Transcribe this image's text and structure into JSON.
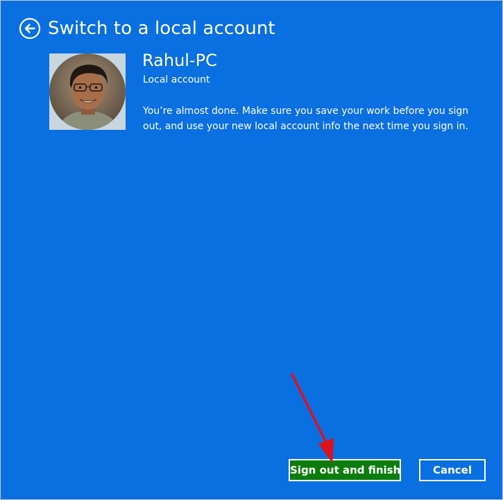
{
  "dialog": {
    "title": "Switch to a local account",
    "back_icon": "back-arrow-icon",
    "background_color": "#0a6fe0"
  },
  "account": {
    "name": "Rahul-PC",
    "type": "Local account",
    "avatar_icon": "user-photo"
  },
  "message": "You’re almost done. Make sure you save your work before you sign out, and use your new local account info the next time you sign in.",
  "buttons": {
    "primary": {
      "label": "Sign out and finish",
      "color": "#0c7d0c"
    },
    "cancel": {
      "label": "Cancel"
    }
  },
  "annotation": {
    "arrow_color": "#e0101a"
  }
}
